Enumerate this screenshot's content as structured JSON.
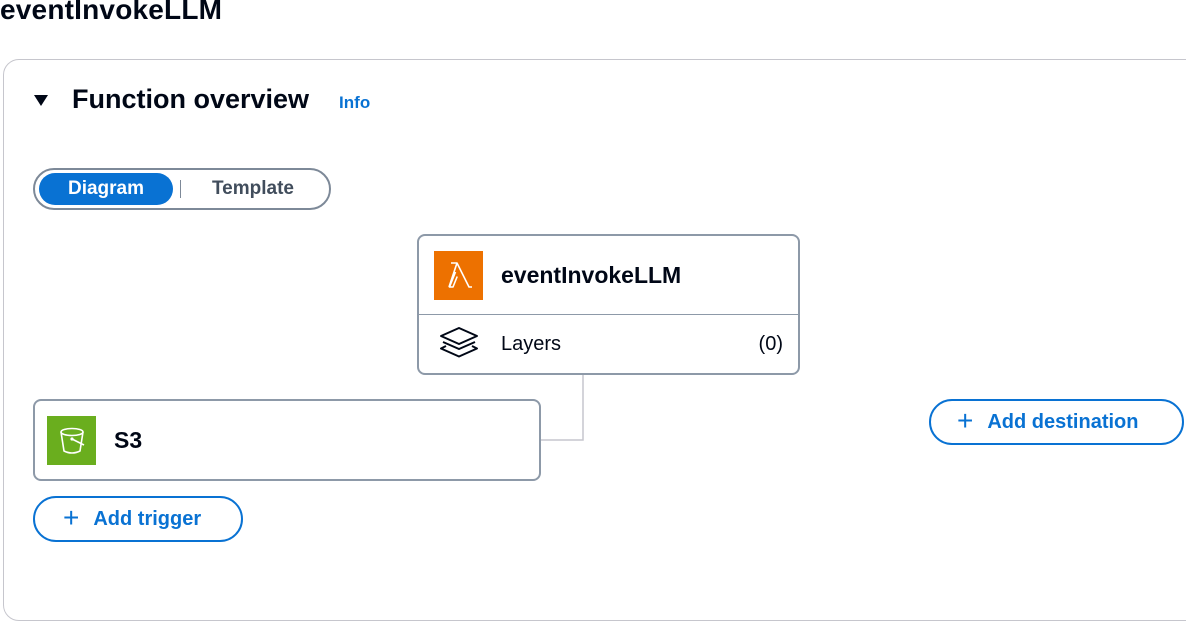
{
  "page": {
    "title": "eventInvokeLLM"
  },
  "overview": {
    "title": "Function overview",
    "info_label": "Info"
  },
  "view_toggle": {
    "options": [
      "Diagram",
      "Template"
    ],
    "selected": "Diagram"
  },
  "function_node": {
    "name": "eventInvokeLLM",
    "icon": "lambda-icon",
    "layers_label": "Layers",
    "layers_count": "(0)"
  },
  "trigger_node": {
    "label": "S3",
    "icon": "s3-bucket-icon"
  },
  "buttons": {
    "add_trigger": "Add trigger",
    "add_destination": "Add destination"
  },
  "colors": {
    "accent": "#0972d3",
    "lambda": "#ed7100",
    "s3": "#6aae1e"
  }
}
